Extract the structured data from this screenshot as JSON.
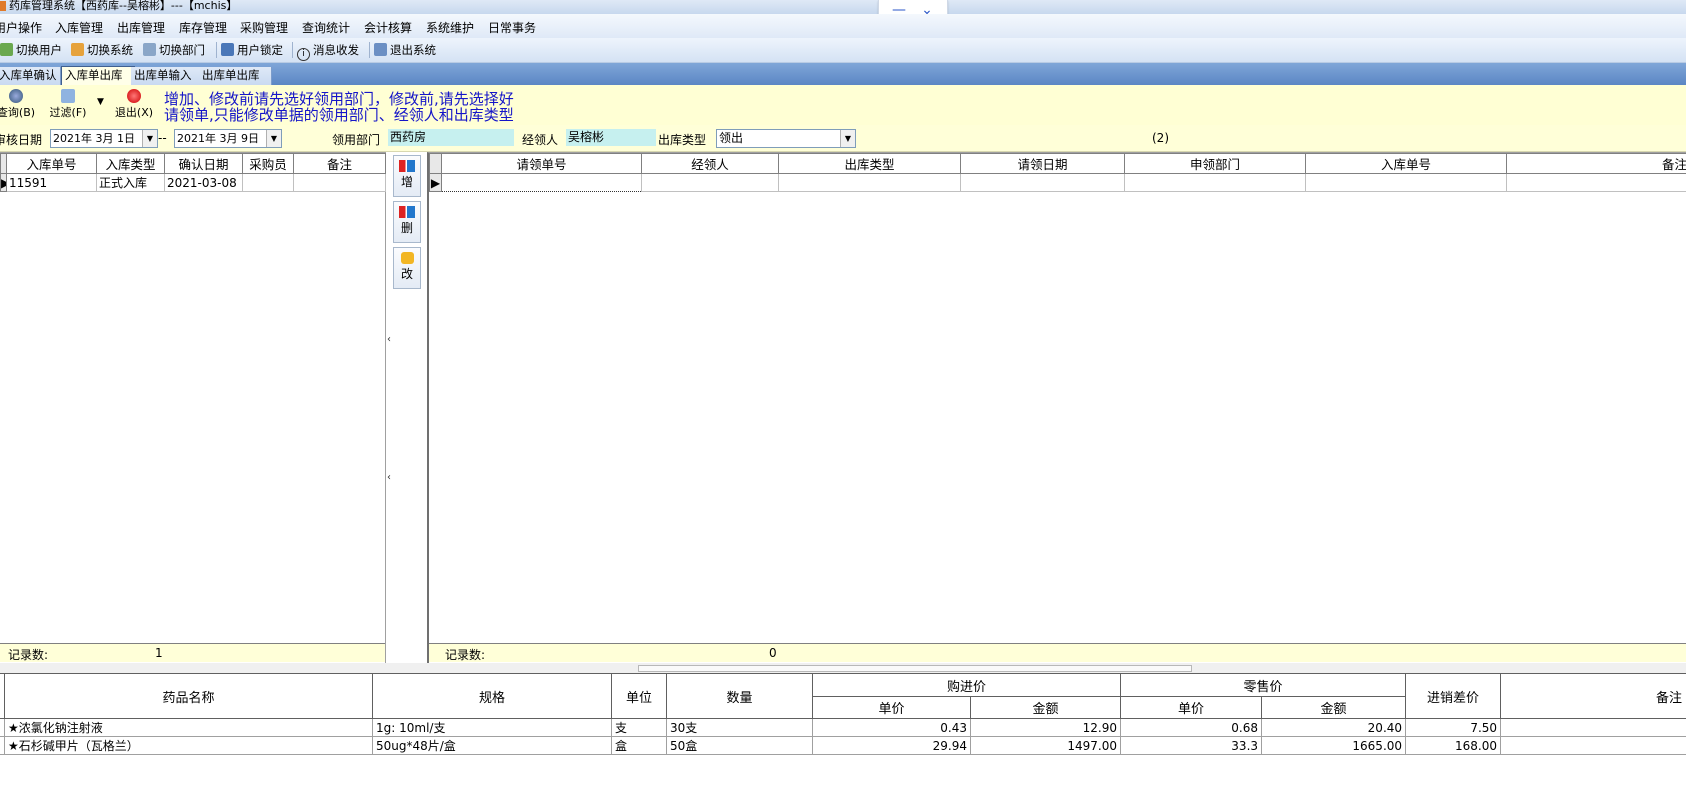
{
  "window": {
    "title": "药库管理系统【西药库--吴榕彬】---【mchis】"
  },
  "menu": [
    "用户操作",
    "入库管理",
    "出库管理",
    "库存管理",
    "采购管理",
    "查询统计",
    "会计核算",
    "系统维护",
    "日常事务"
  ],
  "toolbar": [
    {
      "label": "切换用户",
      "icon": "users-icon"
    },
    {
      "label": "切换系统",
      "icon": "switch-system-icon"
    },
    {
      "label": "切换部门",
      "icon": "department-icon"
    },
    {
      "label": "用户锁定",
      "icon": "user-lock-icon"
    },
    {
      "label": "消息收发",
      "icon": "info-icon"
    },
    {
      "label": "退出系统",
      "icon": "exit-icon"
    }
  ],
  "tabs": [
    "入库单确认",
    "入库单出库",
    "出库单输入",
    "出库单出库"
  ],
  "actions": {
    "query": "查询(B)",
    "filter": "过滤(F)",
    "exit": "退出(X)",
    "hint_line1": "增加、修改前请先选好领用部门，修改前,请先选择好",
    "hint_line2": "请领单,只能修改单据的领用部门、经领人和出库类型"
  },
  "filter": {
    "date_label": "审核日期",
    "date_from": "2021年 3月 1日",
    "date_sep": "--",
    "date_to": "2021年 3月 9日",
    "dept_label": "领用部门",
    "dept_value": "西药房",
    "handler_label": "经领人",
    "handler_value": "吴榕彬",
    "type_label": "出库类型",
    "type_value": "领出",
    "count_text": "(2)"
  },
  "left_grid": {
    "columns": [
      "入库单号",
      "入库类型",
      "确认日期",
      "采购员",
      "备注"
    ],
    "rows": [
      [
        "11591",
        "正式入库",
        "2021-03-08",
        "",
        ""
      ]
    ],
    "footer_label": "记录数:",
    "footer_count": "1"
  },
  "side_buttons": [
    "增",
    "删",
    "改"
  ],
  "right_grid": {
    "columns": [
      "请领单号",
      "经领人",
      "出库类型",
      "请领日期",
      "申领部门",
      "入库单号",
      "备注"
    ],
    "footer_label": "记录数:",
    "footer_count": "0"
  },
  "detail_grid": {
    "headers": {
      "name": "药品名称",
      "spec": "规格",
      "unit": "单位",
      "qty": "数量",
      "purchase": "购进价",
      "retail": "零售价",
      "unit_price": "单价",
      "amount": "金额",
      "diff": "进销差价",
      "remark": "备注"
    },
    "rows": [
      {
        "name": "★浓氯化钠注射液",
        "spec": "1g: 10ml/支",
        "unit": "支",
        "qty": "30支",
        "p_price": "0.43",
        "p_amount": "12.90",
        "r_price": "0.68",
        "r_amount": "20.40",
        "diff": "7.50",
        "remark": ""
      },
      {
        "name": "★石杉碱甲片（瓦格兰）",
        "spec": "50ug*48片/盒",
        "unit": "盒",
        "qty": "50盒",
        "p_price": "29.94",
        "p_amount": "1497.00",
        "r_price": "33.3",
        "r_amount": "1665.00",
        "diff": "168.00",
        "remark": ""
      }
    ]
  }
}
